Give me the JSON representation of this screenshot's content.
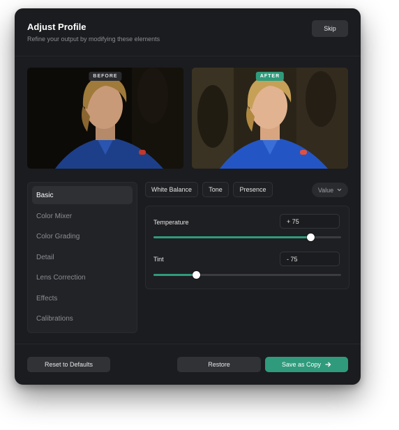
{
  "header": {
    "title": "Adjust Profile",
    "subtitle": "Refine your output by modifying these elements",
    "skip_label": "Skip"
  },
  "preview": {
    "before_label": "BEFORE",
    "after_label": "AFTER"
  },
  "sidebar": {
    "items": [
      {
        "label": "Basic",
        "active": true
      },
      {
        "label": "Color Mixer",
        "active": false
      },
      {
        "label": "Color Grading",
        "active": false
      },
      {
        "label": "Detail",
        "active": false
      },
      {
        "label": "Lens Correction",
        "active": false
      },
      {
        "label": "Effects",
        "active": false
      },
      {
        "label": "Calibrations",
        "active": false
      }
    ]
  },
  "tabs": [
    {
      "label": "White Balance"
    },
    {
      "label": "Tone"
    },
    {
      "label": "Presence"
    }
  ],
  "mode_select": {
    "value": "Value"
  },
  "controls": {
    "temperature": {
      "label": "Temperature",
      "value": "+ 75",
      "slider_fraction": 0.84
    },
    "tint": {
      "label": "Tint",
      "value": "- 75",
      "slider_fraction": 0.23
    }
  },
  "footer": {
    "reset_label": "Reset to Defaults",
    "restore_label": "Restore",
    "save_label": "Save as Copy"
  },
  "colors": {
    "accent": "#2f9b7c",
    "panel": "#1b1c1f"
  }
}
